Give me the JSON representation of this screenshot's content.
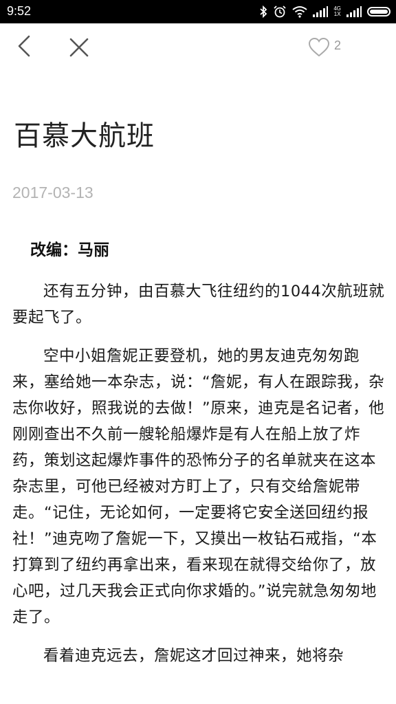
{
  "status_bar": {
    "time": "9:52",
    "network_top": "4G",
    "network_bottom": "1X"
  },
  "toolbar": {
    "like_count": "2"
  },
  "article": {
    "title": "百慕大航班",
    "date": "2017-03-13",
    "author": "改编：马丽",
    "paragraphs": [
      "还有五分钟，由百慕大飞往纽约的1044次航班就要起飞了。",
      "空中小姐詹妮正要登机，她的男友迪克匆匆跑来，塞给她一本杂志，说：“詹妮，有人在跟踪我，杂志你收好，照我说的去做！”原来，迪克是名记者，他刚刚查出不久前一艘轮船爆炸是有人在船上放了炸药，策划这起爆炸事件的恐怖分子的名单就夹在这本杂志里，可他已经被对方盯上了，只有交给詹妮带走。“记住，无论如何，一定要将它安全送回纽约报社！”迪克吻了詹妮一下，又摸出一枚钻石戒指，“本打算到了纽约再拿出来，看来现在就得交给你了，放心吧，过几天我会正式向你求婚的。”说完就急匆匆地走了。",
      "看着迪克远去，詹妮这才回过神来，她将杂"
    ]
  }
}
